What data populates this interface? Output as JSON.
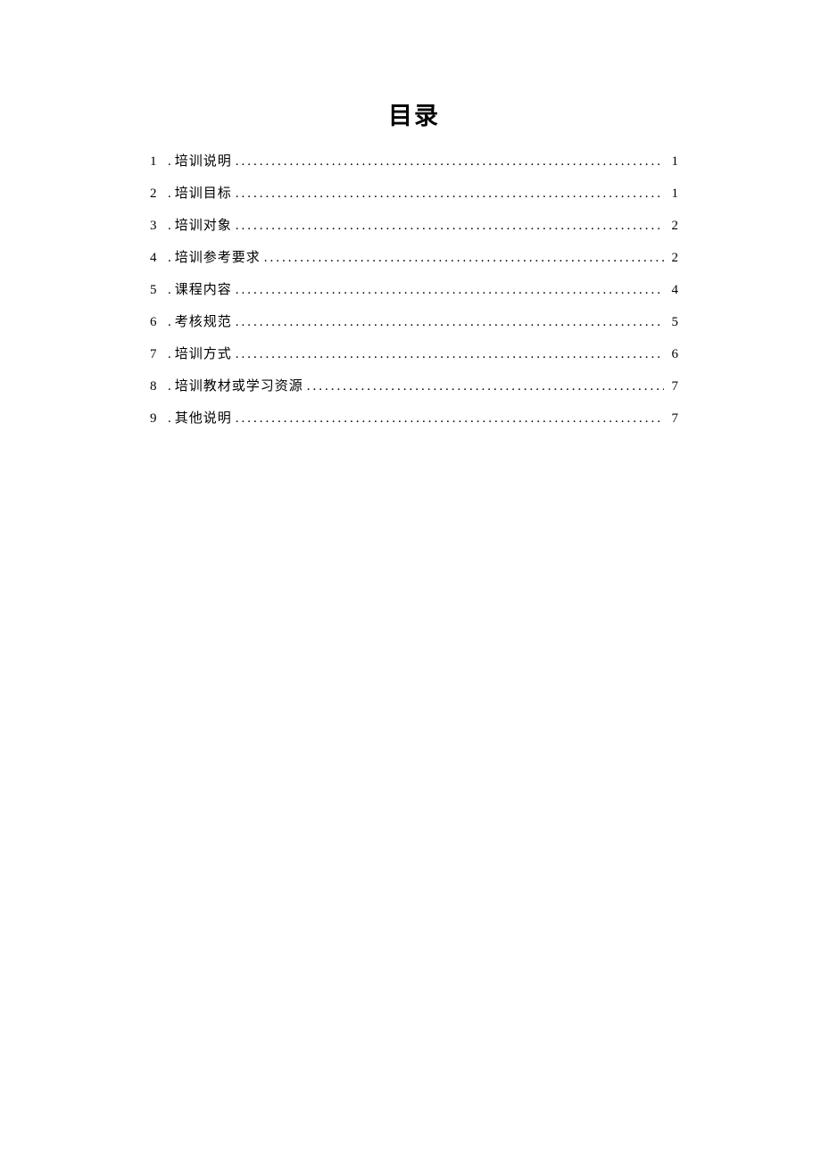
{
  "title": "目录",
  "items": [
    {
      "num": "1",
      "label": "培训说明",
      "page": "1"
    },
    {
      "num": "2",
      "label": "培训目标",
      "page": "1"
    },
    {
      "num": "3",
      "label": "培训对象",
      "page": "2"
    },
    {
      "num": "4",
      "label": "培训参考要求",
      "page": "2"
    },
    {
      "num": "5",
      "label": "课程内容",
      "page": "4"
    },
    {
      "num": "6",
      "label": "考核规范",
      "page": "5"
    },
    {
      "num": "7",
      "label": "培训方式",
      "page": "6"
    },
    {
      "num": "8",
      "label": "培训教材或学习资源",
      "page": "7"
    },
    {
      "num": "9",
      "label": "其他说明",
      "page": "7"
    }
  ],
  "sep": "."
}
